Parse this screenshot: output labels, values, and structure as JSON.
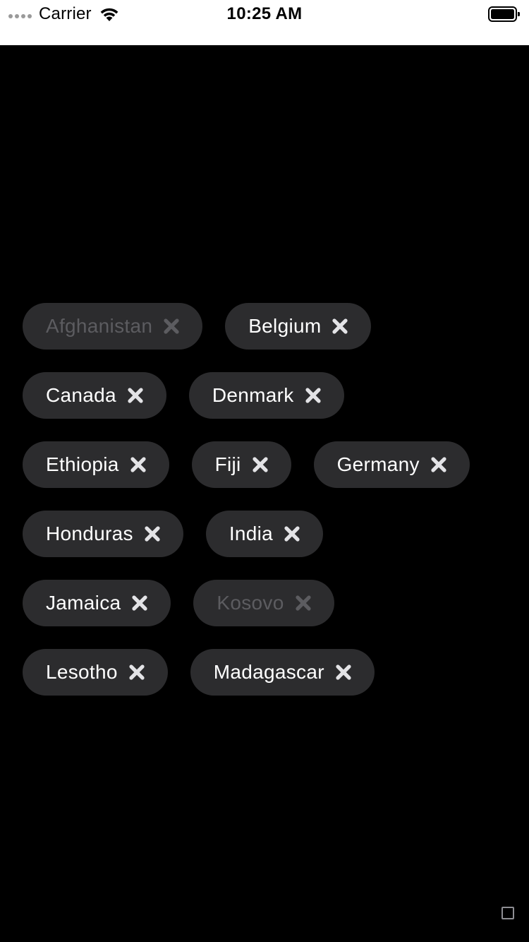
{
  "status_bar": {
    "carrier": "Carrier",
    "time": "10:25 AM",
    "icons": [
      "signal-dots-icon",
      "wifi-icon",
      "battery-icon"
    ]
  },
  "colors": {
    "background": "#000000",
    "chip_background": "#2c2c2e",
    "chip_text": "#ffffff",
    "chip_text_disabled": "#5c5c60",
    "status_bar_background": "#ffffff"
  },
  "chip_rows": [
    [
      {
        "label": "Afghanistan",
        "disabled": true
      },
      {
        "label": "Belgium",
        "disabled": false
      }
    ],
    [
      {
        "label": "Canada",
        "disabled": false
      },
      {
        "label": "Denmark",
        "disabled": false
      }
    ],
    [
      {
        "label": "Ethiopia",
        "disabled": false
      },
      {
        "label": "Fiji",
        "disabled": false
      },
      {
        "label": "Germany",
        "disabled": false
      }
    ],
    [
      {
        "label": "Honduras",
        "disabled": false
      },
      {
        "label": "India",
        "disabled": false
      }
    ],
    [
      {
        "label": "Jamaica",
        "disabled": false
      },
      {
        "label": "Kosovo",
        "disabled": true
      }
    ],
    [
      {
        "label": "Lesotho",
        "disabled": false
      },
      {
        "label": "Madagascar",
        "disabled": false
      }
    ]
  ],
  "chip_close_icon": "close-icon",
  "corner_icon": "square-icon"
}
